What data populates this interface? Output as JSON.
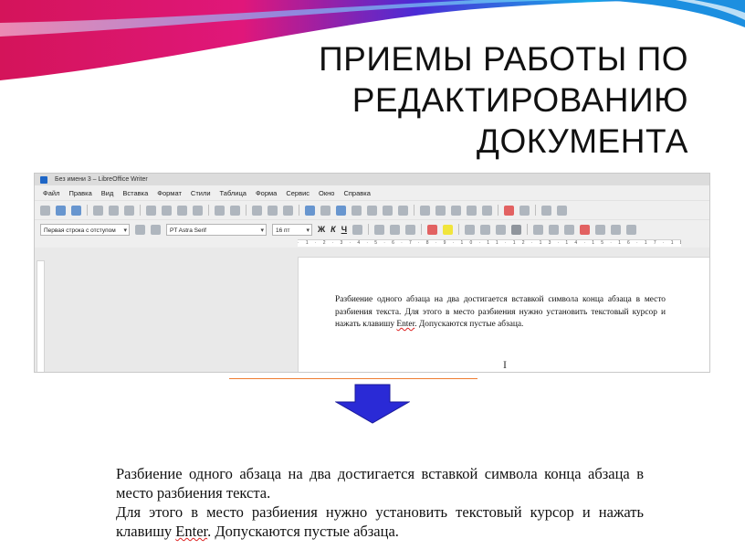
{
  "slide": {
    "title_lines": [
      "ПРИЕМЫ РАБОТЫ ПО",
      "РЕДАКТИРОВАНИЮ",
      "ДОКУМЕНТА"
    ]
  },
  "window": {
    "title": "Без имени 3 – LibreOffice Writer",
    "menu": [
      "Файл",
      "Правка",
      "Вид",
      "Вставка",
      "Формат",
      "Стили",
      "Таблица",
      "Форма",
      "Сервис",
      "Окно",
      "Справка"
    ],
    "paragraph_style": "Первая строка с отступом",
    "font_name": "PT Astra Serif",
    "font_size": "16 пт",
    "bold_label": "Ж",
    "italic_label": "К",
    "underline_label": "Ч",
    "ruler_numbers": "·1·2·3·4·5·6·7·8·9·10·11·12·13·14·15·16·17·18",
    "ibeam": "I",
    "page_text_before": "Разбиение одного абзаца на два достигается вставкой символа конца абзаца в место разбиения текста. Для этого в место разбиения нужно установить текстовый курсор и нажать клавишу ",
    "page_text_enter": "Enter",
    "page_text_after": ". Допускаются пустые абзаца."
  },
  "result": {
    "para1": "Разбиение одного абзаца на два достигается вставкой символа конца абзаца в место разбиения текста.",
    "para2_before": "Для этого в место разбиения нужно установить текстовый курсор и нажать клавишу ",
    "para2_enter": "Enter",
    "para2_after": ". Допускаются пустые абзаца."
  },
  "colors": {
    "arrow_fill": "#2a2ad6",
    "orange_line": "#ef7d31"
  }
}
